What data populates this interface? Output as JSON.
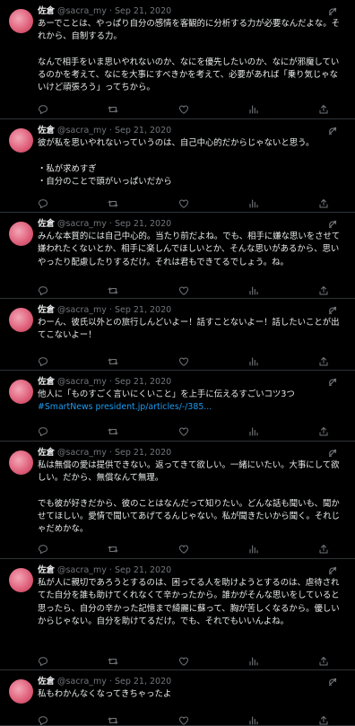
{
  "tweets": [
    {
      "name": "佐倉",
      "meta": "@sacra_my · Sep 21, 2020",
      "text": "あーでことは、やっぱり自分の感情を客観的に分析する力が必要なんだよな。それから、自制する力。\n\nなんで相手をいま思いやれないのか、なにを優先したいのか、なにが邪魔しているのかを考えて、なにを大事にすべきかを考えて、必要があれば「乗り気じゃないけど頑張ろう」ってちから。"
    },
    {
      "name": "佐倉",
      "meta": "@sacra_my · Sep 21, 2020",
      "text": "彼が私を思いやれないっていうのは、自己中心的だからじゃないと思う。\n\n・私が求めすぎ\n・自分のことで頭がいっぱいだから"
    },
    {
      "name": "佐倉",
      "meta": "@sacra_my · Sep 21, 2020",
      "text": "みんな本質的には自己中心的。当たり前だよね。でも、相手に嫌な思いをさせて嫌われたくないとか、相手に楽しんでほしいとか、そんな思いがあるから、思いやったり配慮したりするだけ。それは君もできてるでしょう。ね。"
    },
    {
      "name": "佐倉",
      "meta": "@sacra_my · Sep 21, 2020",
      "text": "わーん、彼氏以外との旅行しんどいよー！話すことないよー！話したいことが出てこないよー！"
    },
    {
      "name": "佐倉",
      "meta": "@sacra_my · Sep 21, 2020",
      "text": "他人に「ものすごく言いにくいこと」を上手に伝えるすごいコツ3つ",
      "hashtag": "#SmartNews",
      "link": "president.jp/articles/-/385..."
    },
    {
      "name": "佐倉",
      "meta": "@sacra_my · Sep 21, 2020",
      "text": "私は無償の愛は提供できない。返ってきて欲しい。一緒にいたい。大事にして欲しい。だから、無償なんて無理。\n\nでも彼が好きだから、彼のことはなんだって知りたい。どんな話も聞いも、聞かせてほしい。愛情で聞いてあげてるんじゃない。私が聞きたいから聞く。それじゃだめかな。"
    },
    {
      "name": "佐倉",
      "meta": "@sacra_my · Sep 21, 2020",
      "text": "私が人に親切であろうとするのは、困ってる人を助けようとするのは、虐待されてた自分を誰も助けてくれなくて辛かったから。誰かがそんな思いをしていると思ったら、自分の辛かった記憶まで綺麗に蘇って、胸が苦しくなるから。優しいからじゃない。自分を助けてるだけ。でも、それでもいいんよね。"
    },
    {
      "name": "佐倉",
      "meta": "@sacra_my · Sep 21, 2020",
      "text": "私もわかんなくなってきちゃったよ"
    }
  ]
}
